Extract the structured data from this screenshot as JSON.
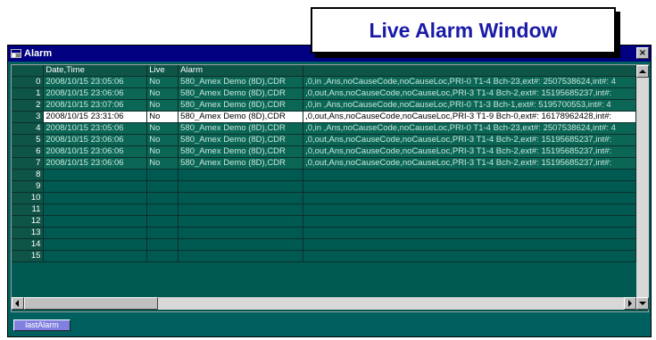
{
  "callout": {
    "label": "Live Alarm Window"
  },
  "window": {
    "title": "Alarm",
    "close_glyph": "×"
  },
  "grid": {
    "columns": [
      "Date,Time",
      "Live",
      "Alarm",
      ""
    ],
    "rows": [
      {
        "num": "0",
        "datetime": "2008/10/15 23:05:06",
        "live": "No",
        "alarm": "580_Amex Demo (8D),CDR",
        "details": ",0,in ,Ans,noCauseCode,noCauseLoc,PRI-0 T1-4 Bch-23,ext#: 2507538624,int#: 4"
      },
      {
        "num": "1",
        "datetime": "2008/10/15 23:06:06",
        "live": "No",
        "alarm": "580_Amex Demo (8D),CDR",
        "details": ",0,out,Ans,noCauseCode,noCauseLoc,PRI-3 T1-4 Bch-2,ext#: 15195685237,int#:"
      },
      {
        "num": "2",
        "datetime": "2008/10/15 23:07:06",
        "live": "No",
        "alarm": "580_Amex Demo (8D),CDR",
        "details": ",0,in ,Ans,noCauseCode,noCauseLoc,PRI-0 T1-3 Bch-1,ext#: 5195700553,int#: 4"
      },
      {
        "num": "3",
        "datetime": "2008/10/15 23:31:06",
        "live": "No",
        "alarm": "580_Amex Demo (8D),CDR",
        "details": ",0,out,Ans,noCauseCode,noCauseLoc,PRI-3 T1-9 Bch-0,ext#: 16178962428,int#:",
        "selected": true
      },
      {
        "num": "4",
        "datetime": "2008/10/15 23:05:06",
        "live": "No",
        "alarm": "580_Amex Demo (8D),CDR",
        "details": ",0,in ,Ans,noCauseCode,noCauseLoc,PRI-0 T1-4 Bch-23,ext#: 2507538624,int#: 4"
      },
      {
        "num": "5",
        "datetime": "2008/10/15 23:06:06",
        "live": "No",
        "alarm": "580_Amex Demo (8D),CDR",
        "details": ",0,out,Ans,noCauseCode,noCauseLoc,PRI-3 T1-4 Bch-2,ext#: 15195685237,int#:"
      },
      {
        "num": "6",
        "datetime": "2008/10/15 23:06:06",
        "live": "No",
        "alarm": "580_Amex Demo (8D),CDR",
        "details": ",0,out,Ans,noCauseCode,noCauseLoc,PRI-3 T1-4 Bch-2,ext#: 15195685237,int#:"
      },
      {
        "num": "7",
        "datetime": "2008/10/15 23:06:06",
        "live": "No",
        "alarm": "580_Amex Demo (8D),CDR",
        "details": ",0,out,Ans,noCauseCode,noCauseLoc,PRI-3 T1-4 Bch-2,ext#: 15195685237,int#:"
      }
    ],
    "empty_rows": [
      "8",
      "9",
      "10",
      "11",
      "12",
      "13",
      "14",
      "15"
    ]
  },
  "buttons": {
    "last_alarm": "lastAlarm"
  }
}
